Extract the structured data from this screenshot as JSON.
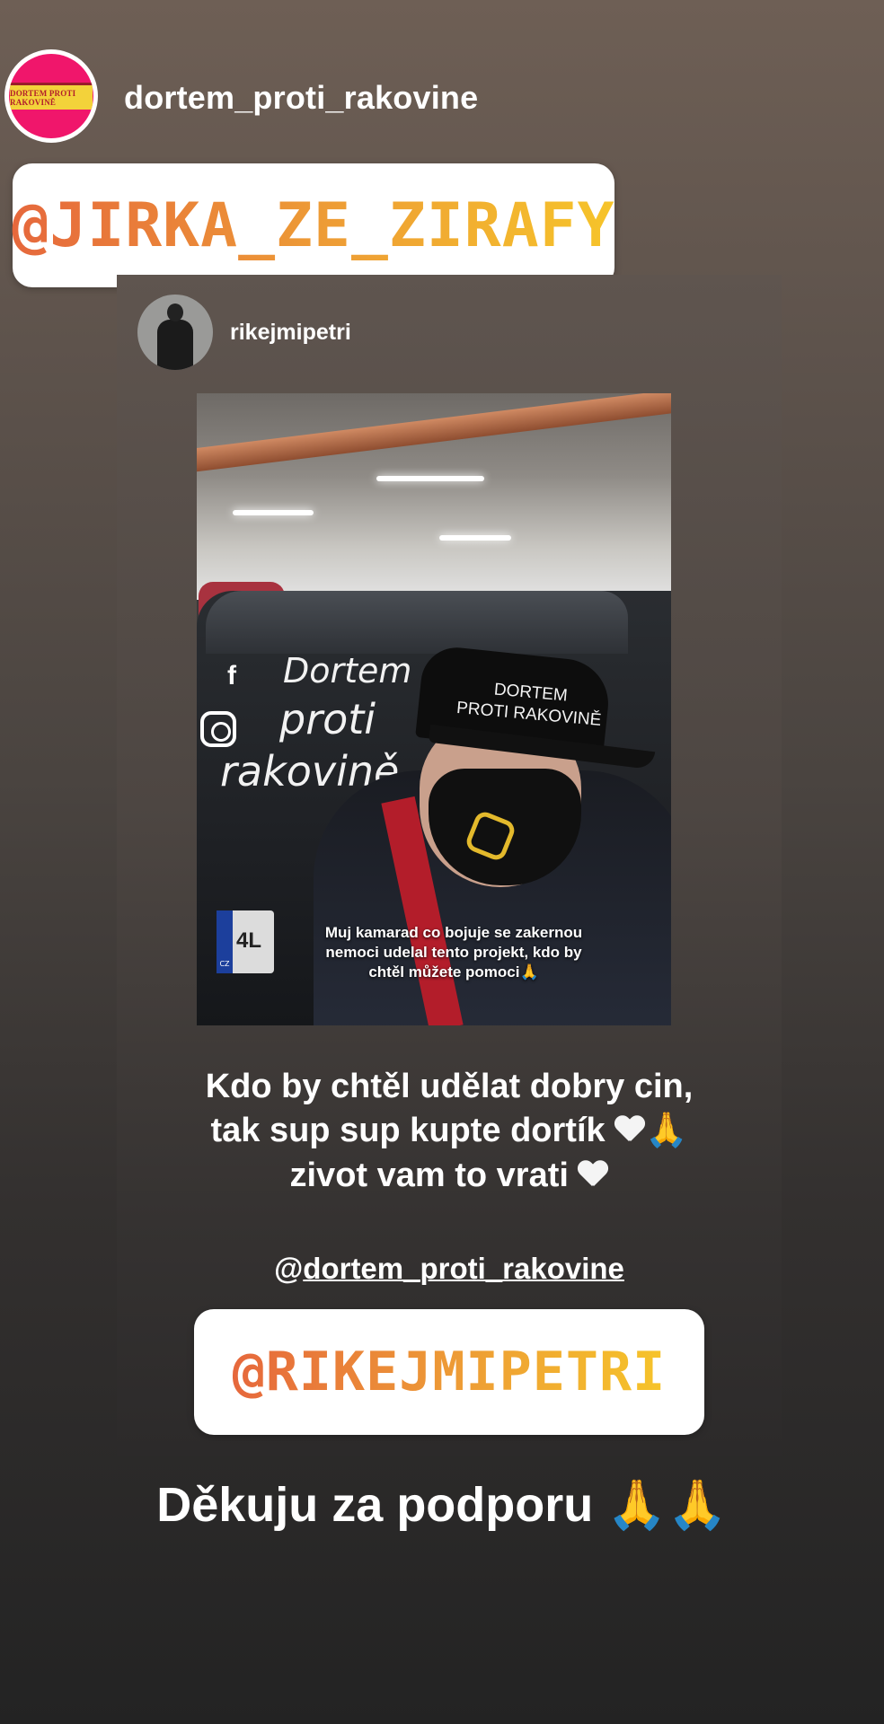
{
  "story": {
    "username": "dortem_proti_rakovine",
    "avatar_logo_text": "DORTEM PROTI RAKOVINĚ",
    "top_mention": "@JIRKA_ZE_ZIRAFY"
  },
  "reshared_post": {
    "username": "rikejmipetri",
    "photo": {
      "car_text_line1": "Dortem",
      "car_text_line2": "proti",
      "car_text_line3": "rakovině",
      "cap_text_line1": "DORTEM",
      "cap_text_line2": "PROTI RAKOVINĚ",
      "plate_country": "CZ",
      "plate_value": "4L",
      "caption": "Muj kamarad co bojuje se zakernou nemoci udelal tento projekt, kdo by chtěl můžete pomoci🙏"
    },
    "message_line1": "Kdo by chtěl udělat dobry cin,",
    "message_line2": "tak sup sup kupte dortík",
    "message_line3": "zivot vam to vrati",
    "mention_prefix": "@",
    "mention_link": "dortem_proti_rakovine",
    "bottom_mention": "@RIKEJMIPETRI"
  },
  "footer": {
    "text": "Děkuju za podporu",
    "emoji": "🙏🙏"
  },
  "colors": {
    "mention_gradient_start": "#e6683c",
    "mention_gradient_end": "#f6c42a",
    "avatar_ring": "#f0166b"
  }
}
